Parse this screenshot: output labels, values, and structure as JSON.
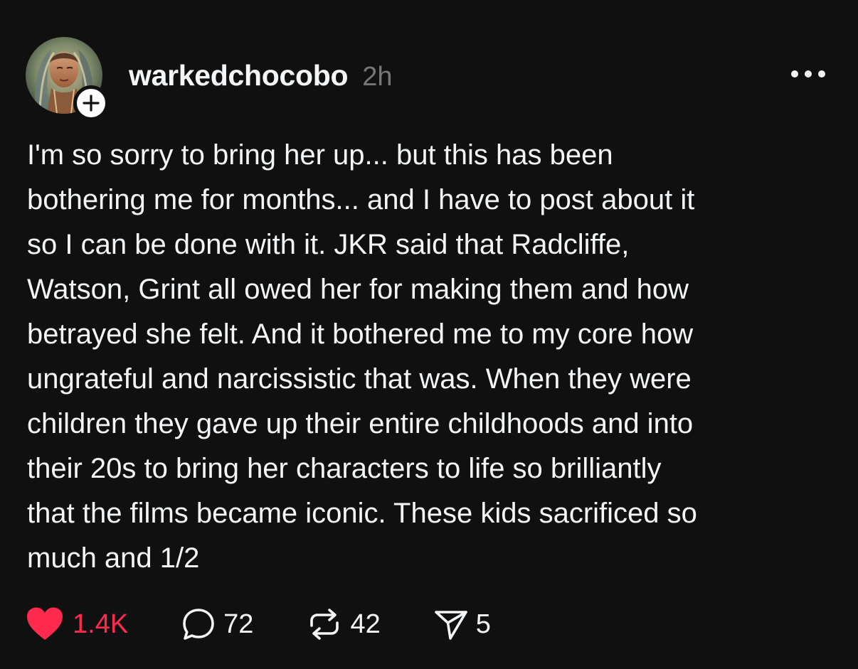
{
  "post": {
    "author": "warkedchocobo",
    "timestamp": "2h",
    "lines": [
      "I'm so sorry to bring her up... but this has been",
      "bothering me for months... and I have to post about it",
      "so I can be done with it. JKR said that Radcliffe,",
      "Watson, Grint all owed her for making them and how",
      "betrayed she felt. And it bothered me to my core how",
      "ungrateful and narcissistic that was. When they were",
      "children they gave up their entire childhoods and into",
      "their 20s to bring her characters to life so brilliantly",
      "that the films became iconic. These kids sacrificed so",
      "much and 1/2"
    ]
  },
  "actions": {
    "likes": "1.4K",
    "replies": "72",
    "reposts": "42",
    "shares": "5"
  },
  "icons": {
    "like": "heart-filled-icon",
    "reply": "speech-bubble-icon",
    "repost": "repost-arrows-icon",
    "share": "paper-plane-icon",
    "more": "ellipsis-icon",
    "follow": "plus-icon"
  },
  "colors": {
    "background": "#101010",
    "text": "#f3f5f7",
    "muted": "#777777",
    "like": "#ff2a4d"
  }
}
